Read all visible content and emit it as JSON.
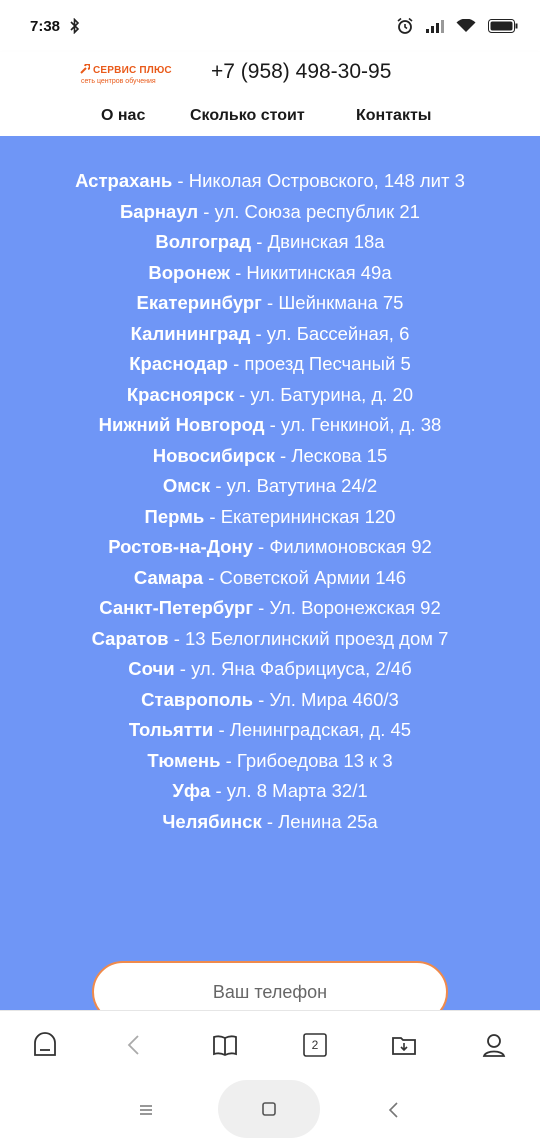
{
  "status_bar": {
    "time": "7:38"
  },
  "header": {
    "logo_title": "СЕРВИС ПЛЮС",
    "logo_subtitle": "сеть центров обучения",
    "phone": "+7 (958) 498-30-95",
    "nav": [
      {
        "label": "О нас"
      },
      {
        "label": "Сколько стоит"
      },
      {
        "label": "Контакты"
      }
    ]
  },
  "cities": [
    {
      "city": "Астрахань",
      "address": "Николая Островского, 148 лит 3"
    },
    {
      "city": "Барнаул",
      "address": "ул. Союза республик 21"
    },
    {
      "city": "Волгоград",
      "address": "Двинская 18а"
    },
    {
      "city": "Воронеж",
      "address": "Никитинская 49а"
    },
    {
      "city": "Екатеринбург",
      "address": "Шейнкмана 75"
    },
    {
      "city": "Калининград",
      "address": "ул. Бассейная, 6"
    },
    {
      "city": "Краснодар",
      "address": "проезд Песчаный 5"
    },
    {
      "city": "Красноярск",
      "address": "ул. Батурина, д. 20"
    },
    {
      "city": "Нижний Новгород",
      "address": "ул. Генкиной, д. 38"
    },
    {
      "city": "Новосибирск",
      "address": "Лескова 15"
    },
    {
      "city": "Омск",
      "address": "ул. Ватутина 24/2"
    },
    {
      "city": "Пермь",
      "address": "Екатерининская 120"
    },
    {
      "city": "Ростов-на-Дону",
      "address": "Филимоновская 92"
    },
    {
      "city": "Самара",
      "address": "Советской Армии 146"
    },
    {
      "city": "Санкт-Петербург",
      "address": "Ул. Воронежская 92"
    },
    {
      "city": "Саратов",
      "address": "13 Белоглинский проезд дом 7"
    },
    {
      "city": "Сочи",
      "address": "ул. Яна Фабрициуса, 2/4б"
    },
    {
      "city": "Ставрополь",
      "address": "Ул. Мира 460/3"
    },
    {
      "city": "Тольятти",
      "address": "Ленинградская, д. 45"
    },
    {
      "city": "Тюмень",
      "address": "Грибоедова 13 к 3"
    },
    {
      "city": "Уфа",
      "address": "ул. 8 Марта 32/1"
    },
    {
      "city": "Челябинск",
      "address": "Ленина 25а"
    }
  ],
  "form": {
    "phone_placeholder": "Ваш телефон"
  },
  "toolbar": {
    "tabs_count": "2"
  },
  "colors": {
    "background": "#6f96f6",
    "accent": "#f08a4b",
    "logo": "#e95a1a"
  }
}
